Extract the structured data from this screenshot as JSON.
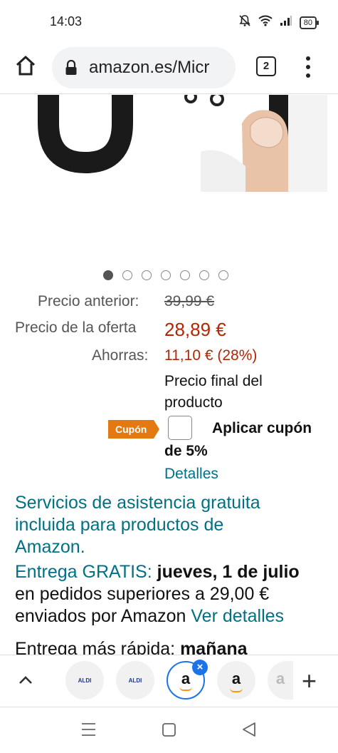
{
  "status_bar": {
    "time": "14:03",
    "battery": "80"
  },
  "browser": {
    "url": "amazon.es/Micr",
    "tab_count": "2"
  },
  "carousel": {
    "total": 7,
    "active_index": 0
  },
  "pricing": {
    "previous_label": "Precio anterior:",
    "previous_price": "39,99 €",
    "offer_label": "Precio de la oferta",
    "offer_price": "28,89 €",
    "savings_label": "Ahorras:",
    "savings_value": "11,10 € (28%)",
    "final_price_note_line1": "Precio final del",
    "final_price_note_line2": "producto"
  },
  "coupon": {
    "badge": "Cupón",
    "apply_text": "Aplicar cupón",
    "apply_text_line2": "de 5%",
    "details_link": "Detalles"
  },
  "services": {
    "line1": "Servicios de asistencia gratuita",
    "line2": "incluida para productos de",
    "line3": "Amazon."
  },
  "delivery": {
    "free_label": "Entrega GRATIS:",
    "date": "jueves, 1 de julio",
    "line2": "en pedidos superiores a 29,00 €",
    "line3_text": "enviados por Amazon",
    "details_link": "Ver detalles",
    "fastest_label": "Entrega más rápida:",
    "fastest_value": "mañana"
  },
  "tab_strip": {
    "tabs": [
      {
        "label": "ALDI"
      },
      {
        "label": "ALDI"
      },
      {
        "label": "a"
      },
      {
        "label": "a"
      },
      {
        "label": "a"
      }
    ]
  },
  "colors": {
    "price_red": "#B12704",
    "link_teal": "#007185",
    "coupon_orange": "#e47911",
    "tab_blue": "#1a73e8"
  }
}
